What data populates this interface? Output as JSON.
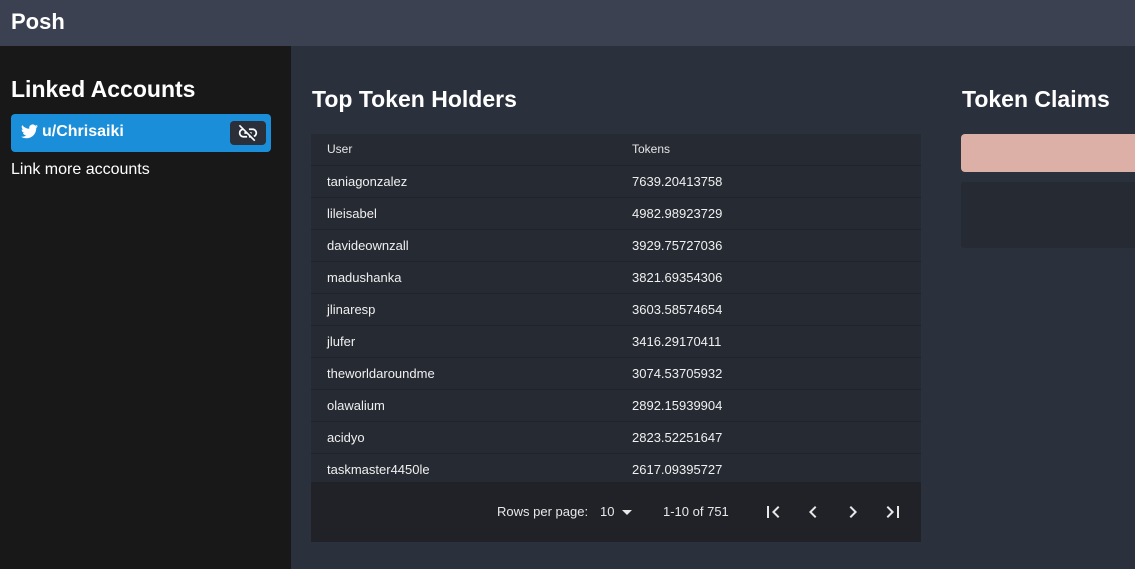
{
  "app": {
    "title": "Posh"
  },
  "sidebar": {
    "heading": "Linked Accounts",
    "account": {
      "name": "u/Chrisaiki",
      "service_icon": "twitter-icon",
      "unlink_icon": "link-off-icon"
    },
    "link_more": "Link more accounts"
  },
  "main": {
    "title": "Top Token Holders",
    "columns": {
      "user": "User",
      "tokens": "Tokens"
    },
    "rows": [
      {
        "user": "taniagonzalez",
        "tokens": "7639.20413758"
      },
      {
        "user": "lileisabel",
        "tokens": "4982.98923729"
      },
      {
        "user": "davideownzall",
        "tokens": "3929.75727036"
      },
      {
        "user": "madushanka",
        "tokens": "3821.69354306"
      },
      {
        "user": "jlinaresp",
        "tokens": "3603.58574654"
      },
      {
        "user": "jlufer",
        "tokens": "3416.29170411"
      },
      {
        "user": "theworldaroundme",
        "tokens": "3074.53705932"
      },
      {
        "user": "olawalium",
        "tokens": "2892.15939904"
      },
      {
        "user": "acidyo",
        "tokens": "2823.52251647"
      },
      {
        "user": "taskmaster4450le",
        "tokens": "2617.09395727"
      }
    ],
    "pagination": {
      "rows_per_page_label": "Rows per page:",
      "rows_per_page": "10",
      "range": "1-10 of 751"
    }
  },
  "claims": {
    "title": "Token Claims",
    "accent": "#dcb0a6"
  }
}
